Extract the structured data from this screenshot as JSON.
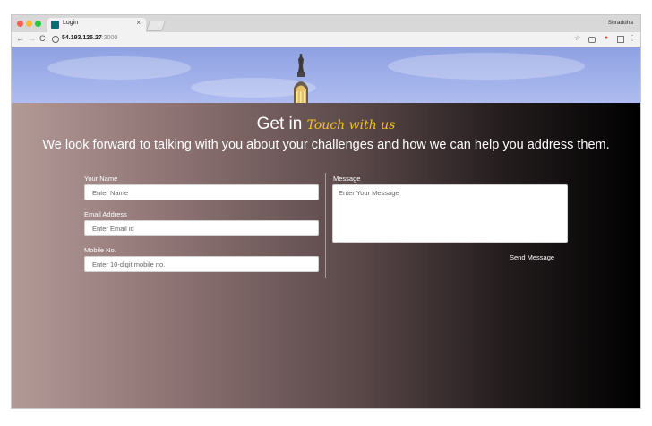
{
  "browser": {
    "tab_title": "Login",
    "tab_close": "×",
    "profile_name": "Shraddha",
    "url_host": "54.193.125.27",
    "url_port": ":3000",
    "nav": {
      "back": "←",
      "forward": "→",
      "reload": "C"
    },
    "icons": [
      "star-icon",
      "camera-icon",
      "extension-icon",
      "window-icon",
      "menu-icon"
    ]
  },
  "hero": {
    "title_main": "Get in",
    "title_script": "Touch with us",
    "subtitle": "We look forward to talking with you about your challenges and how we can help you address them."
  },
  "form": {
    "name_label": "Your Name",
    "name_placeholder": "Enter Name",
    "email_label": "Email Address",
    "email_placeholder": "Enter Email id",
    "mobile_label": "Mobile No.",
    "mobile_placeholder": "Enter 10-digit mobile no.",
    "message_label": "Message",
    "message_placeholder": "Enter Your Message",
    "send_label": "Send Message"
  },
  "colors": {
    "accent_script": "#f2c31a",
    "banner_sky": "#9aaae8"
  }
}
